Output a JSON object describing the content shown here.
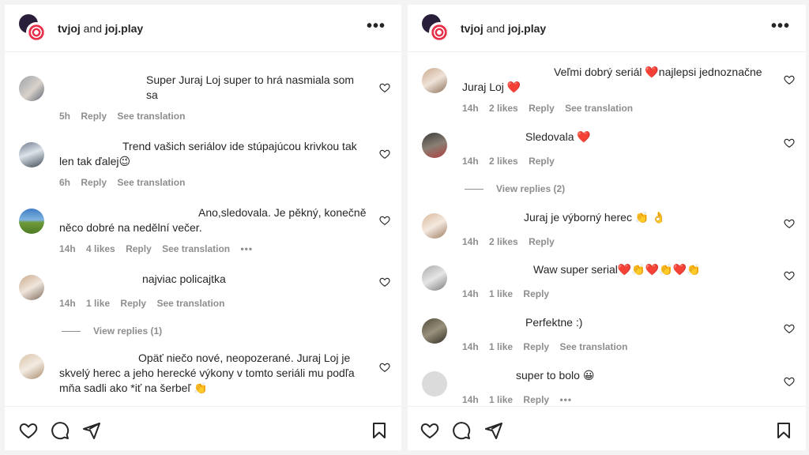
{
  "left": {
    "account": {
      "name1": "tvjoj",
      "and": "and",
      "name2": "joj.play"
    },
    "comments": [
      {
        "text": "Super Juraj Loj super to hrá nasmiala som sa",
        "meta": [
          "5h",
          "Reply",
          "See translation"
        ]
      },
      {
        "text": "Trend vašich seriálov ide stúpajúcou krivkou tak len tak ďalej😉",
        "meta": [
          "6h",
          "Reply",
          "See translation"
        ]
      },
      {
        "text": "Ano,sledovala. Je pěkný, konečně něco dobré na nedělní večer.",
        "meta": [
          "14h",
          "4 likes",
          "Reply",
          "See translation",
          "•••"
        ]
      },
      {
        "text": "najviac policajtka",
        "meta": [
          "14h",
          "1 like",
          "Reply",
          "See translation"
        ],
        "view_replies": "View replies (1)"
      },
      {
        "text": "Opäť niečo nové, neopozerané. Juraj Loj je skvelý herec a jeho herecké výkony v tomto seriáli mu podľa mňa sadli ako *iť na šerbeľ 👏",
        "meta": []
      }
    ]
  },
  "right": {
    "account": {
      "name1": "tvjoj",
      "and": "and",
      "name2": "joj.play"
    },
    "comments": [
      {
        "text": "Veľmi dobrý seriál ❤️najlepsi jednoznačne Juraj Loj ❤️",
        "meta": [
          "14h",
          "2 likes",
          "Reply",
          "See translation"
        ]
      },
      {
        "text": "Sledovala ❤️",
        "meta": [
          "14h",
          "2 likes",
          "Reply"
        ],
        "view_replies": "View replies (2)"
      },
      {
        "text": "Juraj je výborný herec 👏 👌",
        "meta": [
          "14h",
          "2 likes",
          "Reply"
        ]
      },
      {
        "text": "Waw super serial❤️👏❤️👏❤️👏",
        "meta": [
          "14h",
          "1 like",
          "Reply"
        ]
      },
      {
        "text": "Perfektne :)",
        "meta": [
          "14h",
          "1 like",
          "Reply",
          "See translation"
        ]
      },
      {
        "text": "super to bolo 😀",
        "meta": [
          "14h",
          "1 like",
          "Reply",
          "•••"
        ]
      }
    ]
  },
  "icons": [
    "more-icon",
    "heart-icon",
    "like-icon",
    "comment-icon",
    "share-icon",
    "save-icon"
  ]
}
